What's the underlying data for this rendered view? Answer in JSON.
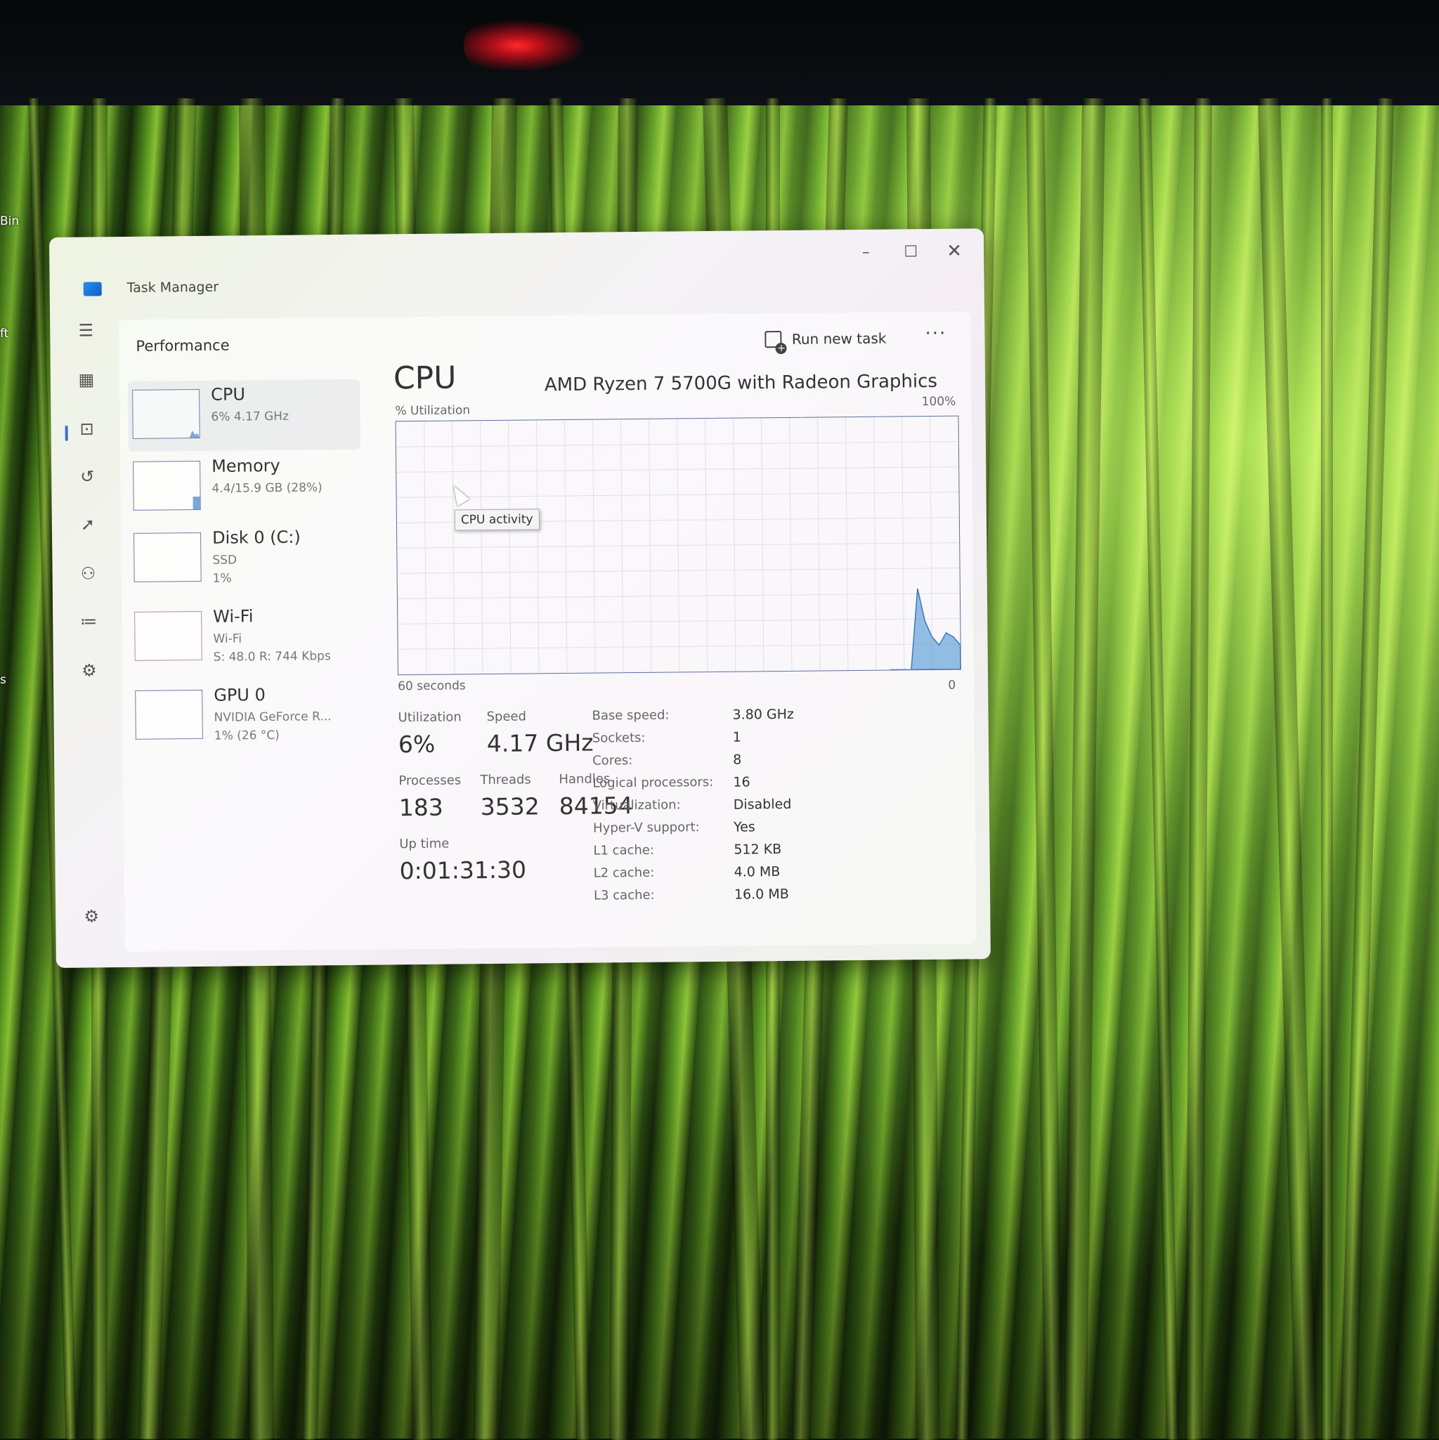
{
  "desktop": {
    "icon_labels": [
      "Bin",
      "ft",
      "s"
    ]
  },
  "window": {
    "title": "Task Manager",
    "controls": {
      "minimize": "–",
      "maximize": "☐",
      "close": "✕"
    }
  },
  "nav_icons": [
    "hamburger-icon",
    "processes-icon",
    "performance-icon",
    "app-history-icon",
    "startup-apps-icon",
    "users-icon",
    "details-icon",
    "services-icon",
    "settings-icon"
  ],
  "header": {
    "page_title": "Performance",
    "run_task_label": "Run new task",
    "more_label": "···"
  },
  "resources": [
    {
      "name": "CPU",
      "line1": "6% 4.17 GHz",
      "line2": ""
    },
    {
      "name": "Memory",
      "line1": "4.4/15.9 GB (28%)",
      "line2": ""
    },
    {
      "name": "Disk 0 (C:)",
      "line1": "SSD",
      "line2": "1%"
    },
    {
      "name": "Wi-Fi",
      "line1": "Wi-Fi",
      "line2": "S: 48.0  R: 744 Kbps"
    },
    {
      "name": "GPU 0",
      "line1": "NVIDIA GeForce R...",
      "line2": "1% (26 °C)"
    }
  ],
  "cpu": {
    "heading": "CPU",
    "model": "AMD Ryzen 7 5700G with Radeon Graphics",
    "graph": {
      "y_label": "% Utilization",
      "y_max_label": "100%",
      "x_label": "60 seconds",
      "x_min_label": "0",
      "tooltip": "CPU activity",
      "recent_utilization_percent": [
        0,
        0,
        0,
        0,
        20,
        12,
        8,
        6,
        9,
        8,
        6
      ]
    },
    "stats": {
      "utilization_label": "Utilization",
      "utilization_value": "6%",
      "speed_label": "Speed",
      "speed_value": "4.17 GHz",
      "processes_label": "Processes",
      "processes_value": "183",
      "threads_label": "Threads",
      "threads_value": "3532",
      "handles_label": "Handles",
      "handles_value": "84154",
      "uptime_label": "Up time",
      "uptime_value": "0:01:31:30"
    },
    "specs": [
      {
        "label": "Base speed:",
        "value": "3.80 GHz"
      },
      {
        "label": "Sockets:",
        "value": "1"
      },
      {
        "label": "Cores:",
        "value": "8"
      },
      {
        "label": "Logical processors:",
        "value": "16"
      },
      {
        "label": "Virtualization:",
        "value": "Disabled"
      },
      {
        "label": "Hyper-V support:",
        "value": "Yes"
      },
      {
        "label": "L1 cache:",
        "value": "512 KB"
      },
      {
        "label": "L2 cache:",
        "value": "4.0 MB"
      },
      {
        "label": "L3 cache:",
        "value": "16.0 MB"
      }
    ]
  }
}
